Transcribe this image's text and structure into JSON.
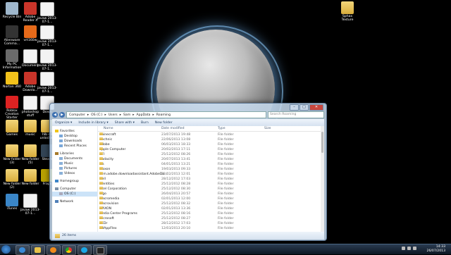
{
  "desktop_icons": [
    {
      "label": "Recycle Bin",
      "type": "recycle"
    },
    {
      "label": "Adobe Reader X",
      "type": "pdf"
    },
    {
      "label": "javaw 2013-07-1...",
      "type": "doc"
    },
    {
      "label": "Alienware Comma...",
      "type": "alien"
    },
    {
      "label": "vrt160w",
      "type": "app"
    },
    {
      "label": "javaw 2013-07-1...",
      "type": "doc"
    },
    {
      "label": "My PC Information",
      "type": "pc"
    },
    {
      "label": "Document",
      "type": "doc"
    },
    {
      "label": "javaw 2013-07-1...",
      "type": "doc"
    },
    {
      "label": "Norton 360",
      "type": "norton"
    },
    {
      "label": "Adobe Downlo...",
      "type": "pdf"
    },
    {
      "label": "javaw 2013-07-1...",
      "type": "doc"
    },
    {
      "label": "Roblox Creation Starter",
      "type": "roblox"
    },
    {
      "label": "photoshop stuff",
      "type": "doc"
    },
    {
      "label": "Down",
      "type": "doc"
    },
    {
      "label": "Games",
      "type": "folder"
    },
    {
      "label": "music",
      "type": "folder"
    },
    {
      "label": "hlb dll unlocked",
      "type": "folder"
    },
    {
      "label": "New folder (3)",
      "type": "folder"
    },
    {
      "label": "New folder (5)",
      "type": "folder"
    },
    {
      "label": "Steam",
      "type": "steam"
    },
    {
      "label": "New folder (2)",
      "type": "folder"
    },
    {
      "label": "New folder",
      "type": "folder"
    },
    {
      "label": "Fraps",
      "type": "fraps"
    },
    {
      "label": "iTunes",
      "type": "itunes"
    },
    {
      "label": "javaw 2013-07-1...",
      "type": "doc"
    }
  ],
  "right_icon": {
    "label": "Sphax Texture"
  },
  "window": {
    "breadcrumb": [
      "Computer",
      "OS (C:)",
      "Users",
      "Sam",
      "AppData",
      "Roaming"
    ],
    "search_placeholder": "Search Roaming",
    "toolbar": [
      "Organize ▾",
      "Include in library ▾",
      "Share with ▾",
      "Burn",
      "New folder"
    ],
    "nav": {
      "favorites": "Favorites",
      "favorites_items": [
        "Desktop",
        "Downloads",
        "Recent Places"
      ],
      "libraries": "Libraries",
      "library_items": [
        "Documents",
        "Music",
        "Pictures",
        "Videos"
      ],
      "homegroup": "Homegroup",
      "computer": "Computer",
      "computer_items": [
        "OS (C:)"
      ],
      "network": "Network"
    },
    "columns": [
      "Name",
      "Date modified",
      "Type",
      "Size"
    ],
    "rows": [
      {
        "name": ".minecraft",
        "date": "23/07/2013 19:48",
        "type": "File folder"
      },
      {
        "name": ".technic",
        "date": "22/06/2013 13:08",
        "type": "File folder"
      },
      {
        "name": "Adobe",
        "date": "06/03/2013 18:33",
        "type": "File folder"
      },
      {
        "name": "Apple Computer",
        "date": "20/02/2013 17:11",
        "type": "File folder"
      },
      {
        "name": "ATI",
        "date": "25/12/2012 08:26",
        "type": "File folder"
      },
      {
        "name": "Audacity",
        "date": "20/07/2013 13:41",
        "type": "File folder"
      },
      {
        "name": "bls",
        "date": "04/01/2013 13:21",
        "type": "File folder"
      },
      {
        "name": "Bloxon",
        "date": "19/03/2013 09:33",
        "type": "File folder"
      },
      {
        "name": "com.adobe.downloadassistant.AdobeDo...",
        "date": "02/02/2013 12:01",
        "type": "File folder"
      },
      {
        "name": "Dell",
        "date": "28/12/2012 17:03",
        "type": "File folder"
      },
      {
        "name": "Identities",
        "date": "25/12/2012 08:28",
        "type": "File folder"
      },
      {
        "name": "Intel Corporation",
        "date": "25/12/2012 08:30",
        "type": "File folder"
      },
      {
        "name": "Ingo",
        "date": "26/04/2013 20:57",
        "type": "File folder"
      },
      {
        "name": "Macromedia",
        "date": "02/01/2013 12:00",
        "type": "File folder"
      },
      {
        "name": "Macrovision",
        "date": "25/12/2012 08:32",
        "type": "File folder"
      },
      {
        "name": "MAXON",
        "date": "02/01/2013 13:36",
        "type": "File folder"
      },
      {
        "name": "Media Center Programs",
        "date": "25/12/2012 08:16",
        "type": "File folder"
      },
      {
        "name": "Microsoft",
        "date": "25/12/2012 08:27",
        "type": "File folder"
      },
      {
        "name": "PCDr",
        "date": "28/12/2012 17:03",
        "type": "File folder"
      },
      {
        "name": "PDAppFlex",
        "date": "12/03/2013 20:10",
        "type": "File folder"
      }
    ],
    "status": "26 items"
  },
  "taskbar": {
    "time": "14:33",
    "date": "26/07/2013"
  }
}
